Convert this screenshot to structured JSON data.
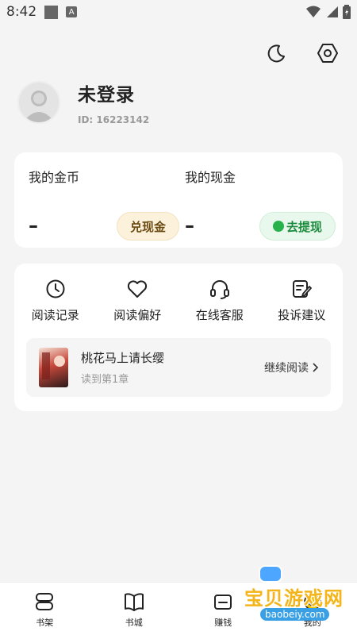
{
  "status_bar": {
    "time": "8:42",
    "a_icon": "A"
  },
  "header": {
    "theme_icon": "moon-icon",
    "settings_icon": "settings-hex-icon"
  },
  "profile": {
    "name": "未登录",
    "id_text": "ID: 16223142"
  },
  "wallet": {
    "coins": {
      "title": "我的金币",
      "value": "–",
      "button": "兑现金"
    },
    "cash": {
      "title": "我的现金",
      "value": "–",
      "button": "去提现"
    }
  },
  "tools": [
    {
      "label": "阅读记录",
      "icon": "clock-icon"
    },
    {
      "label": "阅读偏好",
      "icon": "heart-icon"
    },
    {
      "label": "在线客服",
      "icon": "headset-icon"
    },
    {
      "label": "投诉建议",
      "icon": "feedback-icon"
    }
  ],
  "recent_book": {
    "title": "桃花马上请长缨",
    "progress": "读到第1章",
    "continue": "继续阅读"
  },
  "tabbar": [
    {
      "label": "书架",
      "icon": "bookshelf-icon"
    },
    {
      "label": "书城",
      "icon": "book-icon"
    },
    {
      "label": "赚钱",
      "icon": "wallet-icon"
    },
    {
      "label": "我的",
      "icon": "profile-icon"
    }
  ],
  "watermark": {
    "text": "宝贝游戏网",
    "url": "baobeiy.com"
  },
  "colors": {
    "gold_bg": "#fcf2dc",
    "green_bg": "#e9f8ec",
    "green": "#1b8a3c"
  }
}
